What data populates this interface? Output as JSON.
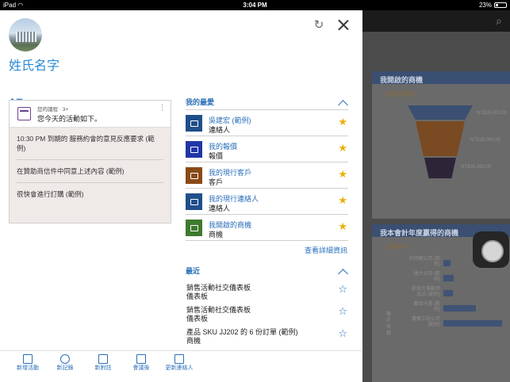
{
  "statusbar": {
    "device": "iPad",
    "wifi_icon": "wifi-icon",
    "time": "3:04 PM",
    "battery": "23%"
  },
  "panel": {
    "user_name": "姓氏名字",
    "refresh_icon": "refresh-icon",
    "close_icon": "close-icon"
  },
  "today": {
    "heading": "今天",
    "card_small": "您的議程 · 3+",
    "card_main": "您今天的活動如下。",
    "items": [
      "10:30 PM 到期的 服務約會的意見反應要求 (範例)",
      "在贊助商信件中同意上述內容 (範例)",
      "很快會進行訂購 (範例)"
    ]
  },
  "favorites": {
    "heading": "我的最愛",
    "items": [
      {
        "title": "吳建宏 (範例)",
        "type": "連絡人",
        "icon": "contact-card-icon",
        "color": "#1f4f8a"
      },
      {
        "title": "我的報價",
        "type": "報價",
        "icon": "quote-document-icon",
        "color": "#2136a6"
      },
      {
        "title": "我的現行客戶",
        "type": "客戶",
        "icon": "account-icon",
        "color": "#8a4a16"
      },
      {
        "title": "我的現行連絡人",
        "type": "連絡人",
        "icon": "contact-card-icon",
        "color": "#1f4f8a"
      },
      {
        "title": "我開啟的商機",
        "type": "商機",
        "icon": "opportunity-icon",
        "color": "#3f7a2e"
      }
    ],
    "see_more": "查看詳細資訊"
  },
  "recent": {
    "heading": "最近",
    "items": [
      {
        "title": "銷售活動社交儀表板",
        "type": "儀表板"
      },
      {
        "title": "銷售活動社交儀表板",
        "type": "儀表板"
      },
      {
        "title": "產品 SKU JJ202 的 6 份訂單 (範例)",
        "type": "商機"
      }
    ]
  },
  "bottom_bar": [
    {
      "label": "新增活動",
      "icon": "new-activity-icon"
    },
    {
      "label": "新記錄",
      "icon": "new-record-icon"
    },
    {
      "label": "新附註",
      "icon": "new-note-icon"
    },
    {
      "label": "會議後",
      "icon": "after-meeting-icon"
    },
    {
      "label": "更新連絡人",
      "icon": "update-contact-icon"
    }
  ],
  "background": {
    "card1_title": "我開啟的商機",
    "card1_sub": "預估營業額",
    "funnel_labels": [
      "NT$25,000.00",
      "NT$15,000.00",
      "NT$35,000.00"
    ],
    "card2_title": "我本會計年度贏得的商機",
    "card2_sub": "贏得客戶",
    "bar_labels": [
      "宏特國公司 (範例)",
      "達大公司 (範例)",
      "凱旋大運動用品店 (範例)",
      "農本光電 (範例)",
      "農寶工程公司 (範例)"
    ],
    "bar_values": [
      0.12,
      0.18,
      0.16,
      0.55,
      1.0
    ],
    "axis_title": "客戶名稱"
  }
}
